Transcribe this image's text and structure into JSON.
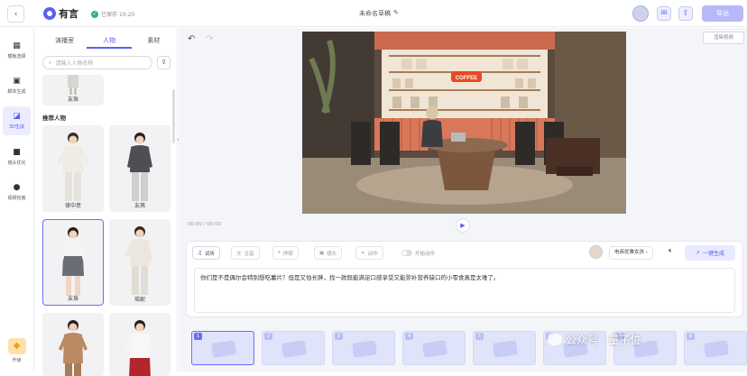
{
  "header": {
    "logo_text": "有言",
    "saved_status": "已保存 10:20",
    "doc_title": "未命名草稿",
    "export_label": "导出"
  },
  "nav": {
    "items": [
      {
        "label": "模板选择",
        "icon": "grid-icon"
      },
      {
        "label": "脚本生成",
        "icon": "text-icon"
      },
      {
        "label": "3D生成",
        "icon": "chart-icon"
      },
      {
        "label": "镜头优化",
        "icon": "camera-icon"
      },
      {
        "label": "视频包装",
        "icon": "film-icon"
      }
    ],
    "upgrade_label": "升级"
  },
  "panel": {
    "tabs": [
      "演播室",
      "人物",
      "素材"
    ],
    "active_tab": "人物",
    "search_placeholder": "请输入人物名称",
    "top_partial_name": "友珠",
    "section_title": "推荐人物",
    "people": [
      {
        "name": "律中意"
      },
      {
        "name": "友茜"
      },
      {
        "name": "友珠"
      },
      {
        "name": "瑶妮"
      },
      {
        "name": ""
      },
      {
        "name": ""
      }
    ]
  },
  "canvas": {
    "render_label": "渲染视频",
    "time": "00:00 / 00:00",
    "sign_text": "COFFEE"
  },
  "editor": {
    "tools": [
      "试听",
      "注音",
      "停顿",
      "镜头",
      "动作",
      "开始动作"
    ],
    "voice_label": "电商优雅女孩 ›",
    "generate_label": "一键生成",
    "script_text": "你们是不是偶尔会特别想吃薯片？但是又怕长胖，找一款既能满足口感享受又能弥补营养缺口的小零食真是太难了。"
  },
  "timeline": {
    "clips": [
      "1",
      "2",
      "3",
      "4",
      "5",
      "6",
      "7",
      "8"
    ]
  },
  "watermark": "公众号 · 量子位"
}
